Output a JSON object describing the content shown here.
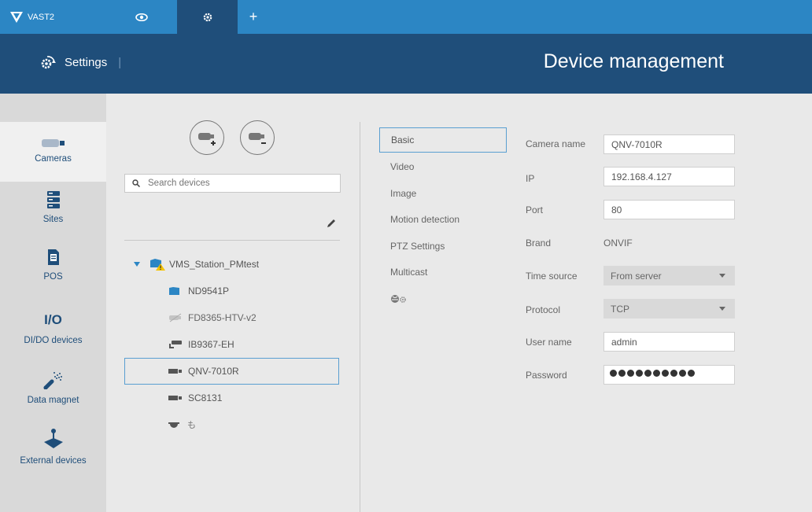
{
  "app": {
    "name": "VAST2"
  },
  "tabs": [
    {
      "id": "live",
      "icon": "eye-icon"
    },
    {
      "id": "settings",
      "icon": "gear-icon",
      "active": true
    },
    {
      "id": "add",
      "icon": "plus-icon",
      "glyph": "+"
    }
  ],
  "header": {
    "section": "Settings",
    "separator": "|",
    "title": "Device management"
  },
  "sidebar": {
    "items": [
      {
        "label": "Cameras",
        "icon": "camera-icon",
        "active": true
      },
      {
        "label": "Sites",
        "icon": "server-icon"
      },
      {
        "label": "POS",
        "icon": "document-icon"
      },
      {
        "label": "DI/DO devices",
        "icon": "io-icon",
        "icon_text": "I/O"
      },
      {
        "label": "Data magnet",
        "icon": "data-magnet-icon"
      },
      {
        "label": "External devices",
        "icon": "joystick-icon"
      }
    ]
  },
  "devices": {
    "search_placeholder": "Search devices",
    "tree": [
      {
        "label": "VMS_Station_PMtest",
        "icon": "station-warning-icon",
        "expanded": true,
        "level": 0
      },
      {
        "label": "ND9541P",
        "icon": "folder-icon",
        "level": 1
      },
      {
        "label": "FD8365-HTV-v2",
        "icon": "camera-disconnected-icon",
        "level": 1
      },
      {
        "label": "IB9367-EH",
        "icon": "bullet-camera-icon",
        "level": 1
      },
      {
        "label": "QNV-7010R",
        "icon": "box-camera-icon",
        "level": 1,
        "selected": true
      },
      {
        "label": "SC8131",
        "icon": "box-camera-icon",
        "level": 1
      },
      {
        "label": "も",
        "icon": "dome-camera-icon",
        "level": 1
      }
    ]
  },
  "settings_tabs": [
    {
      "label": "Basic",
      "active": true
    },
    {
      "label": "Video"
    },
    {
      "label": "Image"
    },
    {
      "label": "Motion detection"
    },
    {
      "label": "PTZ Settings"
    },
    {
      "label": "Multicast"
    },
    {
      "label": "",
      "icon": "advanced-settings-icon"
    }
  ],
  "form": {
    "camera_name": {
      "label": "Camera name",
      "value": "QNV-7010R"
    },
    "ip": {
      "label": "IP",
      "value": "192.168.4.127"
    },
    "port": {
      "label": "Port",
      "value": "80"
    },
    "brand": {
      "label": "Brand",
      "value": "ONVIF"
    },
    "time_source": {
      "label": "Time source",
      "value": "From server"
    },
    "protocol": {
      "label": "Protocol",
      "value": "TCP"
    },
    "user_name": {
      "label": "User name",
      "value": "admin"
    },
    "password": {
      "label": "Password",
      "masked_length": 10
    }
  },
  "colors": {
    "topbar": "#2c86c4",
    "header": "#1f4e7a",
    "accent": "#5a9fd1",
    "folder": "#2c86c4"
  }
}
